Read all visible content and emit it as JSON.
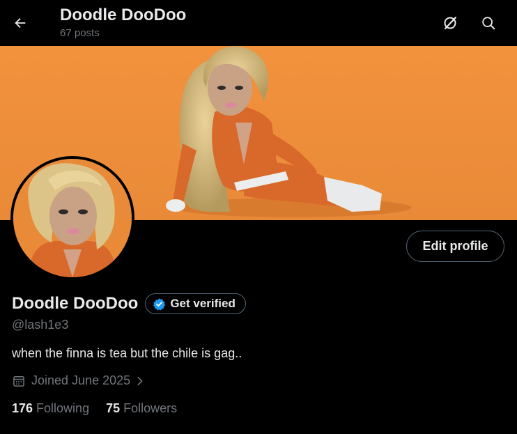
{
  "header": {
    "title": "Doodle DooDoo",
    "post_count": "67 posts",
    "back_icon": "arrow-left-icon",
    "grok_icon": "grok-icon",
    "search_icon": "search-icon"
  },
  "banner": {
    "background_color": "#f2923d"
  },
  "profile": {
    "display_name": "Doodle DooDoo",
    "verify_label": "Get verified",
    "handle": "@lash1e3",
    "bio": "when the finna is tea but the chile is gag..",
    "joined": "Joined June 2025",
    "edit_label": "Edit profile",
    "following_count": "176",
    "following_label": "Following",
    "followers_count": "75",
    "followers_label": "Followers"
  },
  "colors": {
    "background": "#000000",
    "text_primary": "#e7e9ea",
    "text_secondary": "#71767b",
    "verified_blue": "#1d9bf0",
    "border": "#536471"
  }
}
